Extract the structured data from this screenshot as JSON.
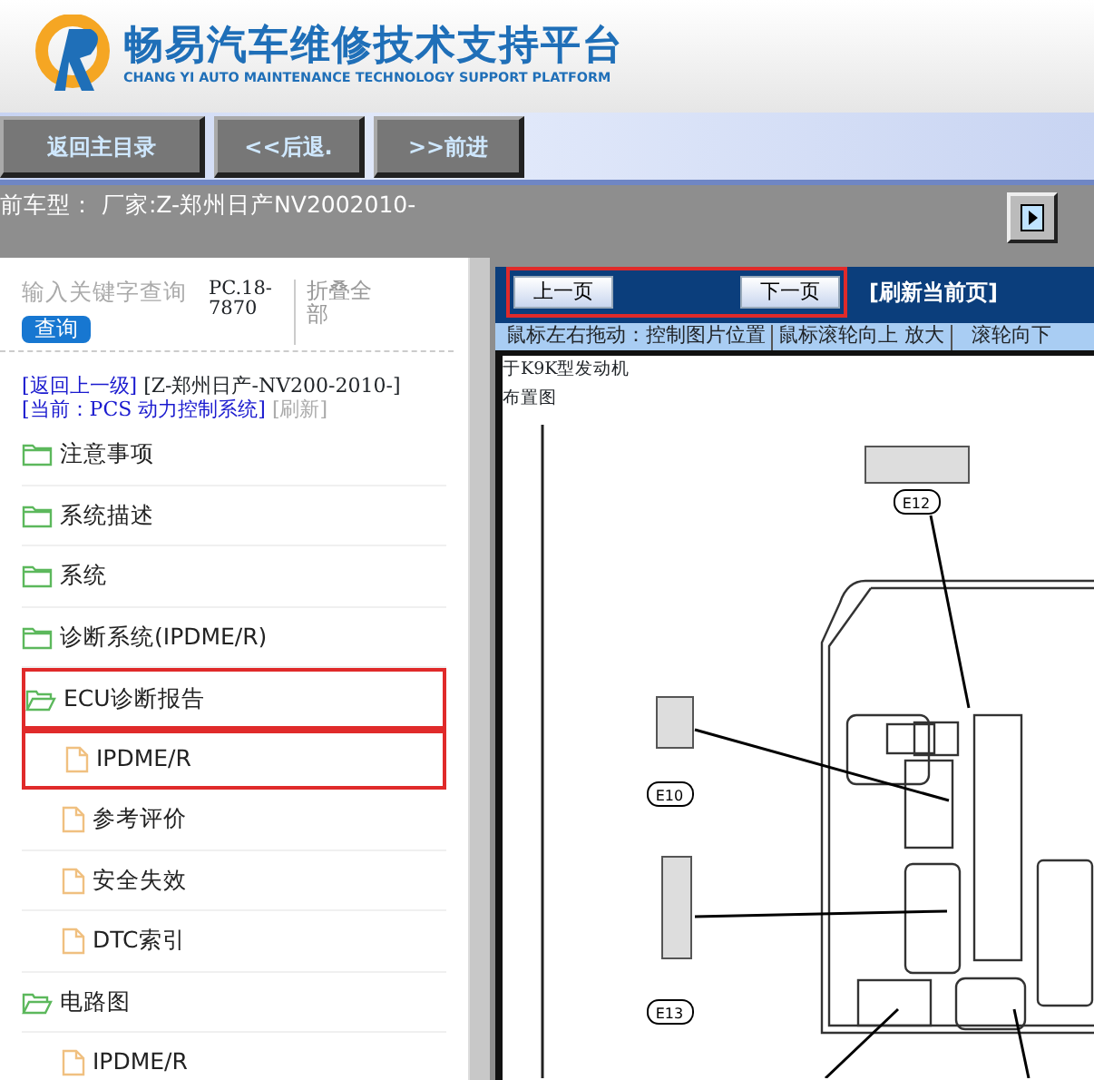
{
  "header": {
    "title": "畅易汽车维修技术支持平台",
    "subtitle": "CHANG YI AUTO MAINTENANCE TECHNOLOGY SUPPORT PLATFORM"
  },
  "nav_buttons": [
    "返回主目录",
    "<<后退.",
    ">>前进"
  ],
  "vehicle_bar": {
    "text": "前车型：  厂家:Z-郑州日产NV2002010-"
  },
  "sidebar": {
    "search": {
      "placeholder": "输入关键字查询",
      "button": "查询"
    },
    "code": "PC.18-7870",
    "collapse_link": "折叠全部",
    "back_link": "[返回上一级]",
    "model": "[Z-郑州日产-NV200-2010-]",
    "current": "[当前：PCS 动力控制系统]",
    "refresh": "[刷新]",
    "tree": [
      {
        "label": "注意事项",
        "kind": "folder",
        "expanded": false,
        "highlighted": false
      },
      {
        "label": "系统描述",
        "kind": "folder",
        "expanded": false,
        "highlighted": false
      },
      {
        "label": "系统",
        "kind": "folder",
        "expanded": false,
        "highlighted": false
      },
      {
        "label": "诊断系统(IPDME/R)",
        "kind": "folder",
        "expanded": false,
        "highlighted": false
      },
      {
        "label": "ECU诊断报告",
        "kind": "folder",
        "expanded": true,
        "highlighted": true,
        "children": [
          {
            "label": "IPDME/R",
            "kind": "page",
            "highlighted": true
          },
          {
            "label": "参考评价",
            "kind": "page",
            "highlighted": false
          },
          {
            "label": "安全失效",
            "kind": "page",
            "highlighted": false
          },
          {
            "label": "DTC索引",
            "kind": "page",
            "highlighted": false
          }
        ]
      },
      {
        "label": "电路图",
        "kind": "folder",
        "expanded": true,
        "highlighted": false,
        "children": [
          {
            "label": "IPDME/R",
            "kind": "page",
            "highlighted": false
          }
        ]
      }
    ]
  },
  "viewer": {
    "prev": "上一页",
    "next": "下一页",
    "pager_highlighted": true,
    "refresh": "[刷新当前页]",
    "hints": [
      "鼠标左右拖动：控制图片位置",
      "鼠标滚轮向上 放大",
      "滚轮向下"
    ],
    "document": {
      "caption": "于K9K型发动机",
      "subtitle": "布置图",
      "connectors": [
        "E12",
        "E10",
        "E13"
      ]
    }
  }
}
